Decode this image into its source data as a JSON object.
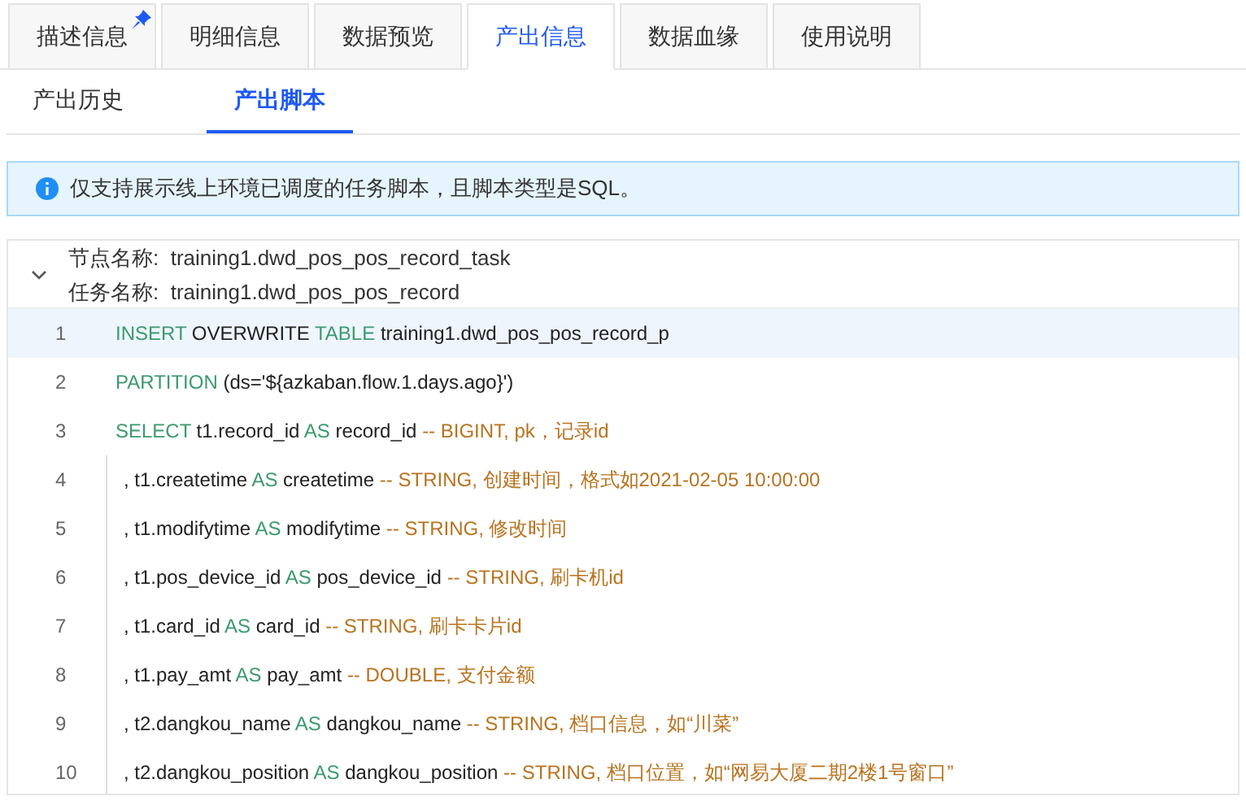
{
  "tabs": [
    {
      "label": "描述信息",
      "selected": false,
      "pinned": true
    },
    {
      "label": "明细信息",
      "selected": false,
      "pinned": false
    },
    {
      "label": "数据预览",
      "selected": false,
      "pinned": false
    },
    {
      "label": "产出信息",
      "selected": true,
      "pinned": false
    },
    {
      "label": "数据血缘",
      "selected": false,
      "pinned": false
    },
    {
      "label": "使用说明",
      "selected": false,
      "pinned": false
    }
  ],
  "subtabs": [
    {
      "label": "产出历史",
      "selected": false
    },
    {
      "label": "产出脚本",
      "selected": true
    }
  ],
  "notice": "仅支持展示线上环境已调度的任务脚本，且脚本类型是SQL。",
  "script": {
    "expanded": true,
    "node_label": "节点名称:",
    "node_name": "training1.dwd_pos_pos_record_task",
    "task_label": "任务名称:",
    "task_name": "training1.dwd_pos_pos_record",
    "lines": [
      {
        "number": "1",
        "selected": true,
        "tokens": [
          {
            "kind": "keyword",
            "text": "INSERT"
          },
          {
            "kind": "plain",
            "text": " OVERWRITE "
          },
          {
            "kind": "keyword",
            "text": "TABLE"
          },
          {
            "kind": "plain",
            "text": " training1.dwd_pos_pos_record_p"
          }
        ]
      },
      {
        "number": "2",
        "selected": false,
        "tokens": [
          {
            "kind": "keyword",
            "text": "PARTITION"
          },
          {
            "kind": "plain",
            "text": " (ds='${azkaban.flow.1.days.ago}')"
          }
        ]
      },
      {
        "number": "3",
        "selected": false,
        "tokens": [
          {
            "kind": "keyword",
            "text": "SELECT"
          },
          {
            "kind": "plain",
            "text": " t1.record_id "
          },
          {
            "kind": "keyword",
            "text": "AS"
          },
          {
            "kind": "plain",
            "text": " record_id "
          },
          {
            "kind": "comment",
            "text": "-- BIGINT, pk，记录id"
          }
        ],
        "children": [
          {
            "number": "4",
            "selected": false,
            "tokens": [
              {
                "kind": "plain",
                "text": ", t1.createtime "
              },
              {
                "kind": "keyword",
                "text": "AS"
              },
              {
                "kind": "plain",
                "text": " createtime "
              },
              {
                "kind": "comment",
                "text": "-- STRING, 创建时间，格式如2021-02-05 10:00:00"
              }
            ]
          },
          {
            "number": "5",
            "selected": false,
            "tokens": [
              {
                "kind": "plain",
                "text": ", t1.modifytime "
              },
              {
                "kind": "keyword",
                "text": "AS"
              },
              {
                "kind": "plain",
                "text": " modifytime "
              },
              {
                "kind": "comment",
                "text": "-- STRING, 修改时间"
              }
            ]
          },
          {
            "number": "6",
            "selected": false,
            "tokens": [
              {
                "kind": "plain",
                "text": ", t1.pos_device_id "
              },
              {
                "kind": "keyword",
                "text": "AS"
              },
              {
                "kind": "plain",
                "text": " pos_device_id "
              },
              {
                "kind": "comment",
                "text": "-- STRING, 刷卡机id"
              }
            ]
          },
          {
            "number": "7",
            "selected": false,
            "tokens": [
              {
                "kind": "plain",
                "text": ", t1.card_id "
              },
              {
                "kind": "keyword",
                "text": "AS"
              },
              {
                "kind": "plain",
                "text": " card_id "
              },
              {
                "kind": "comment",
                "text": "-- STRING, 刷卡卡片id"
              }
            ]
          },
          {
            "number": "8",
            "selected": false,
            "tokens": [
              {
                "kind": "plain",
                "text": ", t1.pay_amt "
              },
              {
                "kind": "keyword",
                "text": "AS"
              },
              {
                "kind": "plain",
                "text": " pay_amt "
              },
              {
                "kind": "comment",
                "text": "-- DOUBLE, 支付金额"
              }
            ]
          },
          {
            "number": "9",
            "selected": false,
            "tokens": [
              {
                "kind": "plain",
                "text": ", t2.dangkou_name "
              },
              {
                "kind": "keyword",
                "text": "AS"
              },
              {
                "kind": "plain",
                "text": " dangkou_name "
              },
              {
                "kind": "comment",
                "text": "-- STRING, 档口信息，如“川菜”"
              }
            ]
          },
          {
            "number": "10",
            "selected": false,
            "tokens": [
              {
                "kind": "plain",
                "text": ", t2.dangkou_position "
              },
              {
                "kind": "keyword",
                "text": "AS"
              },
              {
                "kind": "plain",
                "text": " dangkou_position "
              },
              {
                "kind": "comment",
                "text": "-- STRING, 档口位置，如“网易大厦二期2楼1号窗口”"
              }
            ]
          }
        ]
      }
    ]
  }
}
